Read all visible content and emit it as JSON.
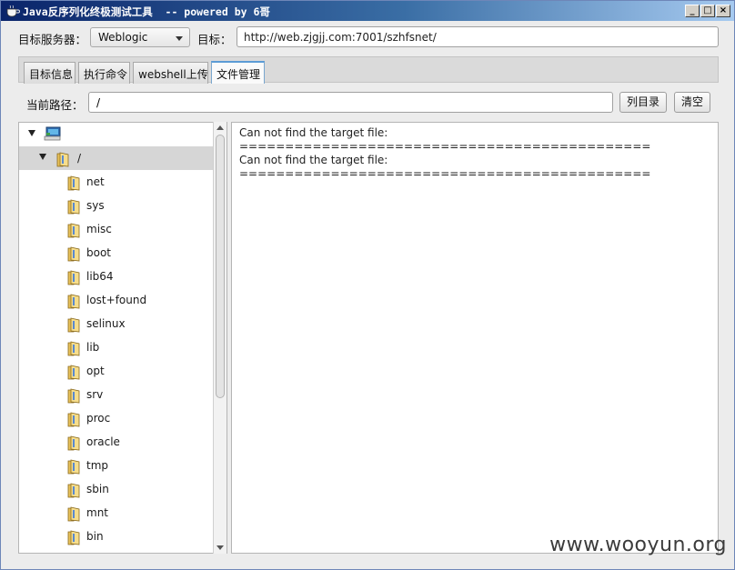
{
  "window": {
    "title": "Java反序列化终极测试工具  -- powered by 6哥",
    "controls": [
      "_",
      "□",
      "×"
    ]
  },
  "target": {
    "server_label": "目标服务器：",
    "server_value": "Weblogic",
    "target_label": "目标：",
    "target_url": "http://web.zjgjj.com:7001/szhfsnet/"
  },
  "tabs": [
    {
      "label": "目标信息",
      "active": false
    },
    {
      "label": "执行命令",
      "active": false
    },
    {
      "label": "webshell上传",
      "active": false
    },
    {
      "label": "文件管理",
      "active": true
    }
  ],
  "path": {
    "label": "当前路径：",
    "value": "/",
    "list_button": "列目录",
    "clear_button": "清空"
  },
  "tree": {
    "root_label": "/",
    "items": [
      "net",
      "sys",
      "misc",
      "boot",
      "lib64",
      "lost+found",
      "selinux",
      "lib",
      "opt",
      "srv",
      "proc",
      "oracle",
      "tmp",
      "sbin",
      "mnt",
      "bin"
    ]
  },
  "output": {
    "lines": [
      "Can not find the target file:",
      "=============================================",
      "Can not find the target file:",
      "============================================="
    ]
  },
  "watermark": "www.wooyun.org"
}
